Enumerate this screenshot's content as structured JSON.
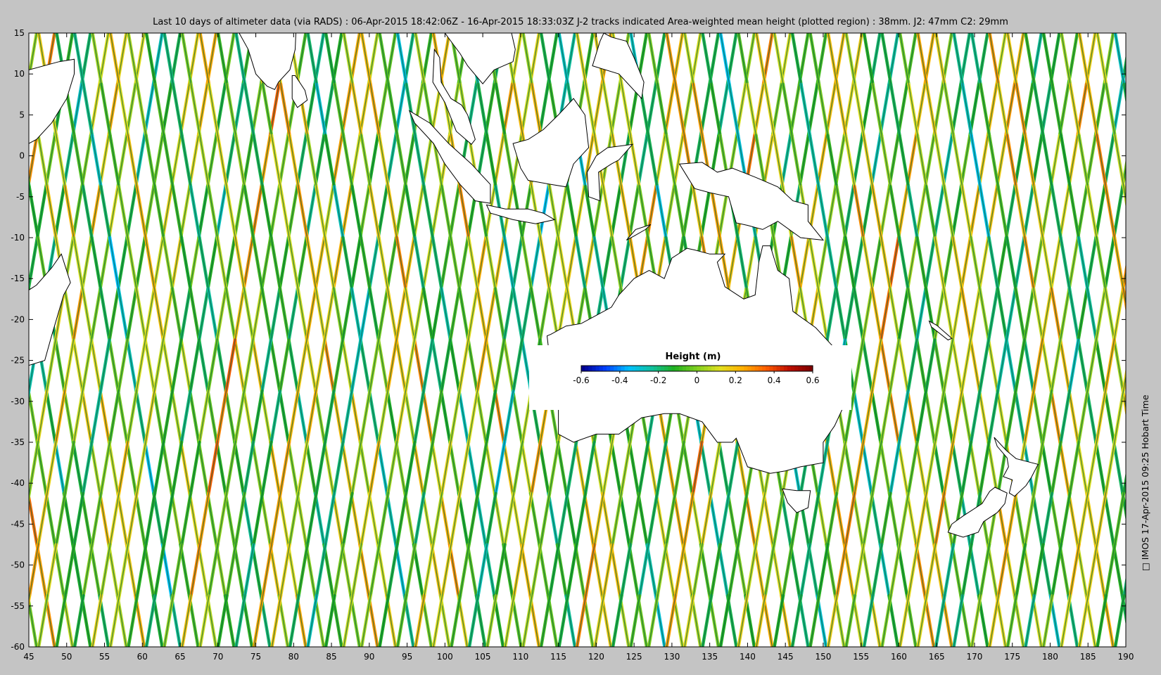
{
  "title": "Last 10 days of altimeter data (via RADS) : 06-Apr-2015 18:42:06Z - 16-Apr-2015 18:33:03Z  J-2 tracks indicated  Area-weighted mean height (plotted region) : 38mm.  J2: 47mm  C2: 29mm",
  "credit": "□ IMOS 17-Apr-2015 09:25 Hobart Time",
  "map": {
    "lon_range": [
      45,
      190
    ],
    "lat_range": [
      -60,
      15
    ],
    "x_ticks": [
      "45",
      "50",
      "55",
      "60",
      "65",
      "70",
      "75",
      "80",
      "85",
      "90",
      "95",
      "100",
      "105",
      "110",
      "115",
      "120",
      "125",
      "130",
      "135",
      "140",
      "145",
      "150",
      "155",
      "160",
      "165",
      "170",
      "175",
      "180",
      "185",
      "190"
    ],
    "y_ticks": [
      "15",
      "10",
      "5",
      "0",
      "-5",
      "-10",
      "-15",
      "-20",
      "-25",
      "-30",
      "-35",
      "-40",
      "-45",
      "-50",
      "-55",
      "-60"
    ],
    "colors": {
      "background": "#c4c4c4",
      "ocean": "#ffffff",
      "land": "#ffffff",
      "coastline": "#000000",
      "track_dark": "#0b5e45"
    }
  },
  "colorbar": {
    "title": "Height (m)",
    "ticks": [
      "-0.6",
      "-0.4",
      "-0.2",
      "0",
      "0.2",
      "0.4",
      "0.6"
    ],
    "range": [
      -0.6,
      0.6
    ],
    "colormap": [
      "#00008f",
      "#0040ff",
      "#00c0ff",
      "#10c0a0",
      "#20b020",
      "#80d020",
      "#e0e020",
      "#ffb000",
      "#ff6000",
      "#c01000",
      "#800000"
    ]
  }
}
